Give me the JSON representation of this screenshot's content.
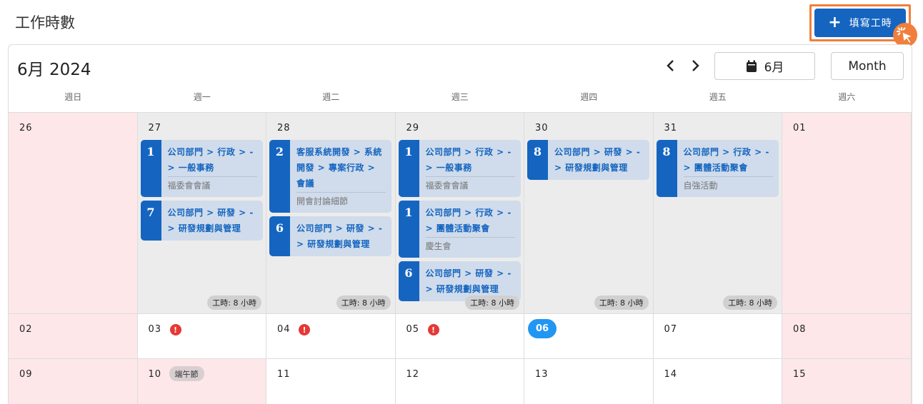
{
  "page_title": "工作時數",
  "add_button_label": "填寫工時",
  "calendar": {
    "month_title": "6月 2024",
    "month_picker_label": "6月",
    "view_label": "Month",
    "weekdays": [
      "週日",
      "週一",
      "週二",
      "週三",
      "週四",
      "週五",
      "週六"
    ],
    "hours_badge": "工時: 8 小時",
    "rows": [
      [
        {
          "day": "26",
          "type": "weekend"
        },
        {
          "day": "27",
          "type": "past",
          "hours": true,
          "events": [
            {
              "n": "1",
              "title": "公司部門 > 行政 > - > 一般事務",
              "sub": "福委會會議"
            },
            {
              "n": "7",
              "title": "公司部門 > 研發 > - > 研發規劃與管理",
              "sub": ""
            }
          ]
        },
        {
          "day": "28",
          "type": "past",
          "hours": true,
          "events": [
            {
              "n": "2",
              "title": "客服系統開發 > 系統開發 > 專案行政 > 會議",
              "sub": "開會討論細節"
            },
            {
              "n": "6",
              "title": "公司部門 > 研發 > - > 研發規劃與管理",
              "sub": ""
            }
          ]
        },
        {
          "day": "29",
          "type": "past",
          "hours": true,
          "events": [
            {
              "n": "1",
              "title": "公司部門 > 行政 > - > 一般事務",
              "sub": "福委會會議"
            },
            {
              "n": "1",
              "title": "公司部門 > 行政 > - > 團體活動聚會",
              "sub": "慶生會"
            },
            {
              "n": "6",
              "title": "公司部門 > 研發 > - > 研發規劃與管理",
              "sub": ""
            }
          ]
        },
        {
          "day": "30",
          "type": "past",
          "hours": true,
          "events": [
            {
              "n": "8",
              "title": "公司部門 > 研發 > - > 研發規劃與管理",
              "sub": ""
            }
          ]
        },
        {
          "day": "31",
          "type": "past",
          "hours": true,
          "events": [
            {
              "n": "8",
              "title": "公司部門 > 行政 > - > 團體活動聚會",
              "sub": "自強活動"
            }
          ]
        },
        {
          "day": "01",
          "type": "weekend"
        }
      ],
      [
        {
          "day": "02",
          "type": "weekend"
        },
        {
          "day": "03",
          "type": "normal",
          "alert": "!"
        },
        {
          "day": "04",
          "type": "normal",
          "alert": "!"
        },
        {
          "day": "05",
          "type": "normal",
          "alert": "!"
        },
        {
          "day": "06",
          "type": "today"
        },
        {
          "day": "07",
          "type": "normal"
        },
        {
          "day": "08",
          "type": "weekend"
        }
      ],
      [
        {
          "day": "09",
          "type": "weekend"
        },
        {
          "day": "10",
          "type": "weekend",
          "holiday": "端午節"
        },
        {
          "day": "11",
          "type": "normal"
        },
        {
          "day": "12",
          "type": "normal"
        },
        {
          "day": "13",
          "type": "normal"
        },
        {
          "day": "14",
          "type": "normal"
        },
        {
          "day": "15",
          "type": "weekend"
        }
      ]
    ]
  },
  "icons": {
    "prev": "chevron-left-icon",
    "next": "chevron-right-icon",
    "calendar": "calendar-icon",
    "plus": "plus-icon",
    "cursor": "click-cursor-icon",
    "alert": "alert-icon"
  },
  "colors": {
    "primary": "#1565c0",
    "today": "#2196f3",
    "weekend": "#fde7e9",
    "past": "#ececec",
    "event_bg": "#d0dceb",
    "highlight": "#f07f3c",
    "alert": "#e53935"
  }
}
